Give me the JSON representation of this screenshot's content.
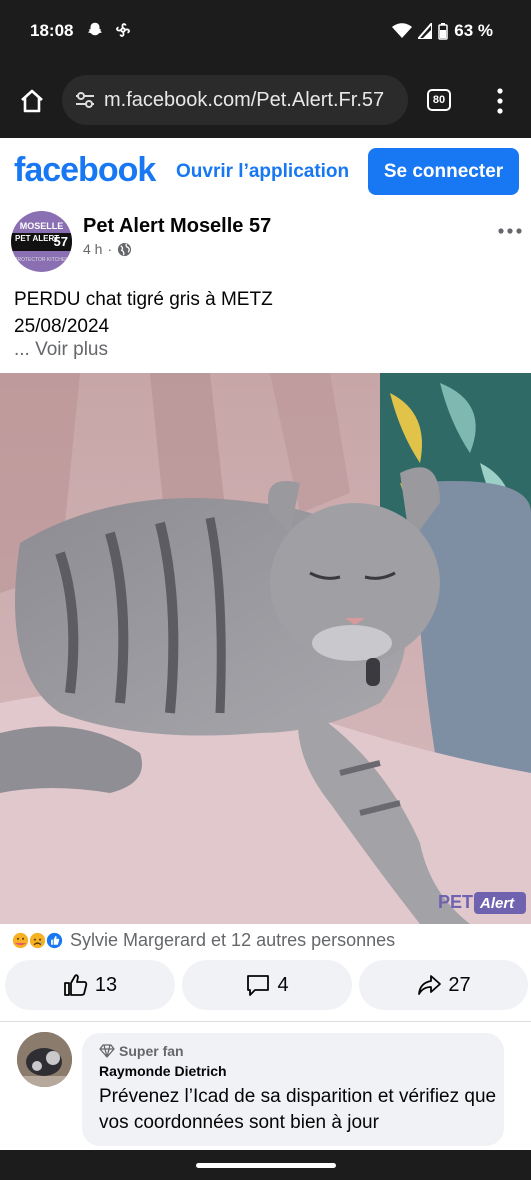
{
  "status": {
    "time": "18:08",
    "battery": "63 %"
  },
  "browser": {
    "url": "m.facebook.com/Pet.Alert.Fr.57",
    "tab_count": "80"
  },
  "fb_header": {
    "logo": "facebook",
    "open_app": "Ouvrir l’application",
    "login": "Se connecter"
  },
  "avatar": {
    "line1": "MOSELLE",
    "line2": "PET ALERT",
    "line3": "57",
    "line4": "PROTECTOR KITCHEN"
  },
  "post": {
    "page_name": "Pet Alert Moselle 57",
    "time": "4 h",
    "dot": "·",
    "text_line1": "PERDU  chat tigré gris à METZ",
    "text_line2": "25/08/2024",
    "see_more": "... Voir plus",
    "watermark_pet": "PET",
    "watermark_alert": "Alert"
  },
  "reactions": {
    "summary": "Sylvie Margerard et 12 autres personnes"
  },
  "actions": {
    "like_count": "13",
    "comment_count": "4",
    "share_count": "27"
  },
  "comment": {
    "badge": "Super fan",
    "author": "Raymonde Dietrich",
    "text": "Prévenez l’Icad de sa disparition et vérifiez que vos coordonnées sont bien à jour"
  },
  "colors": {
    "brand": "#1877f2",
    "status_bg": "#1c1c1c",
    "muted": "#65676b",
    "button_bg": "#f0f2f5"
  }
}
